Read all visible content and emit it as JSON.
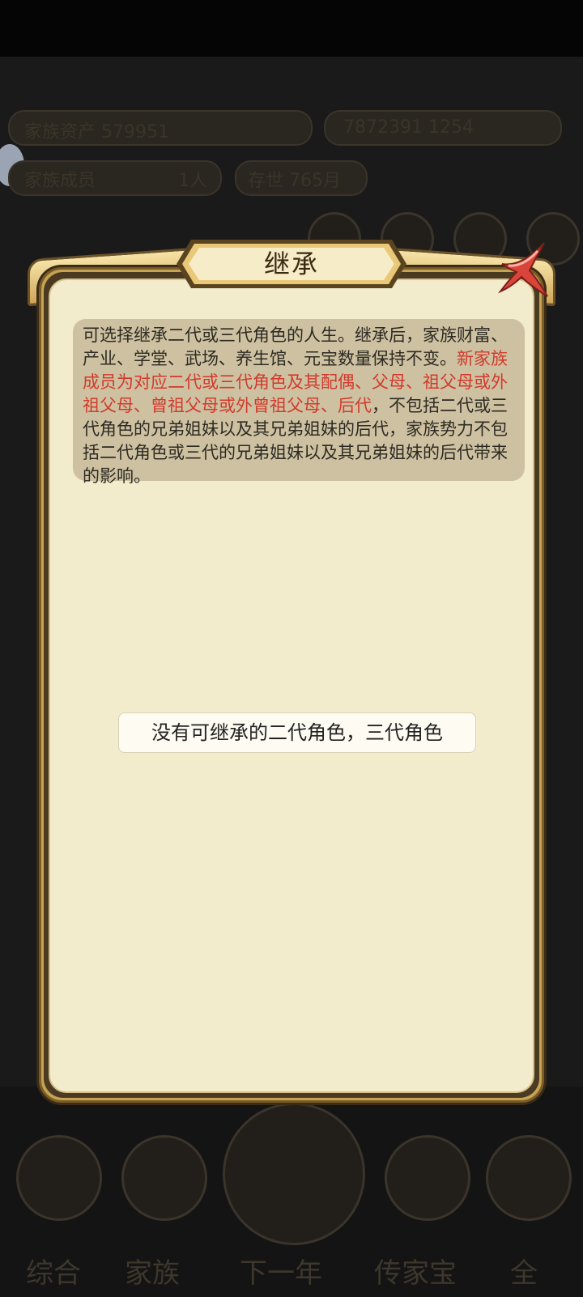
{
  "background": {
    "top_left_text": "家族资产 579951",
    "top_right_text": "7872391 1254",
    "members_text": "家族成员",
    "members_count": "1人",
    "age_text": "存世 765月",
    "nav_labels": [
      "综合",
      "家族",
      "下一年",
      "传家宝",
      "全"
    ]
  },
  "dialog": {
    "title": "继承",
    "description_part1": "可选择继承二代或三代角色的人生。继承后，家族财富、产业、学堂、武场、养生馆、元宝数量保持不变。",
    "description_highlight": "新家族成员为对应二代或三代角色及其配偶、父母、祖父母或外祖父母、曾祖父母或外曾祖父母、后代",
    "description_part2": "，不包括二代或三代角色的兄弟姐妹以及其兄弟姐妹的后代，家族势力不包括二代角色或三代的兄弟姐妹以及其兄弟姐妹的后代带来的影响。",
    "empty_message": "没有可继承的二代角色，三代角色",
    "colors": {
      "highlight": "#d23a2c",
      "body": "#f2ebcc",
      "frame": "#c6a253"
    }
  }
}
